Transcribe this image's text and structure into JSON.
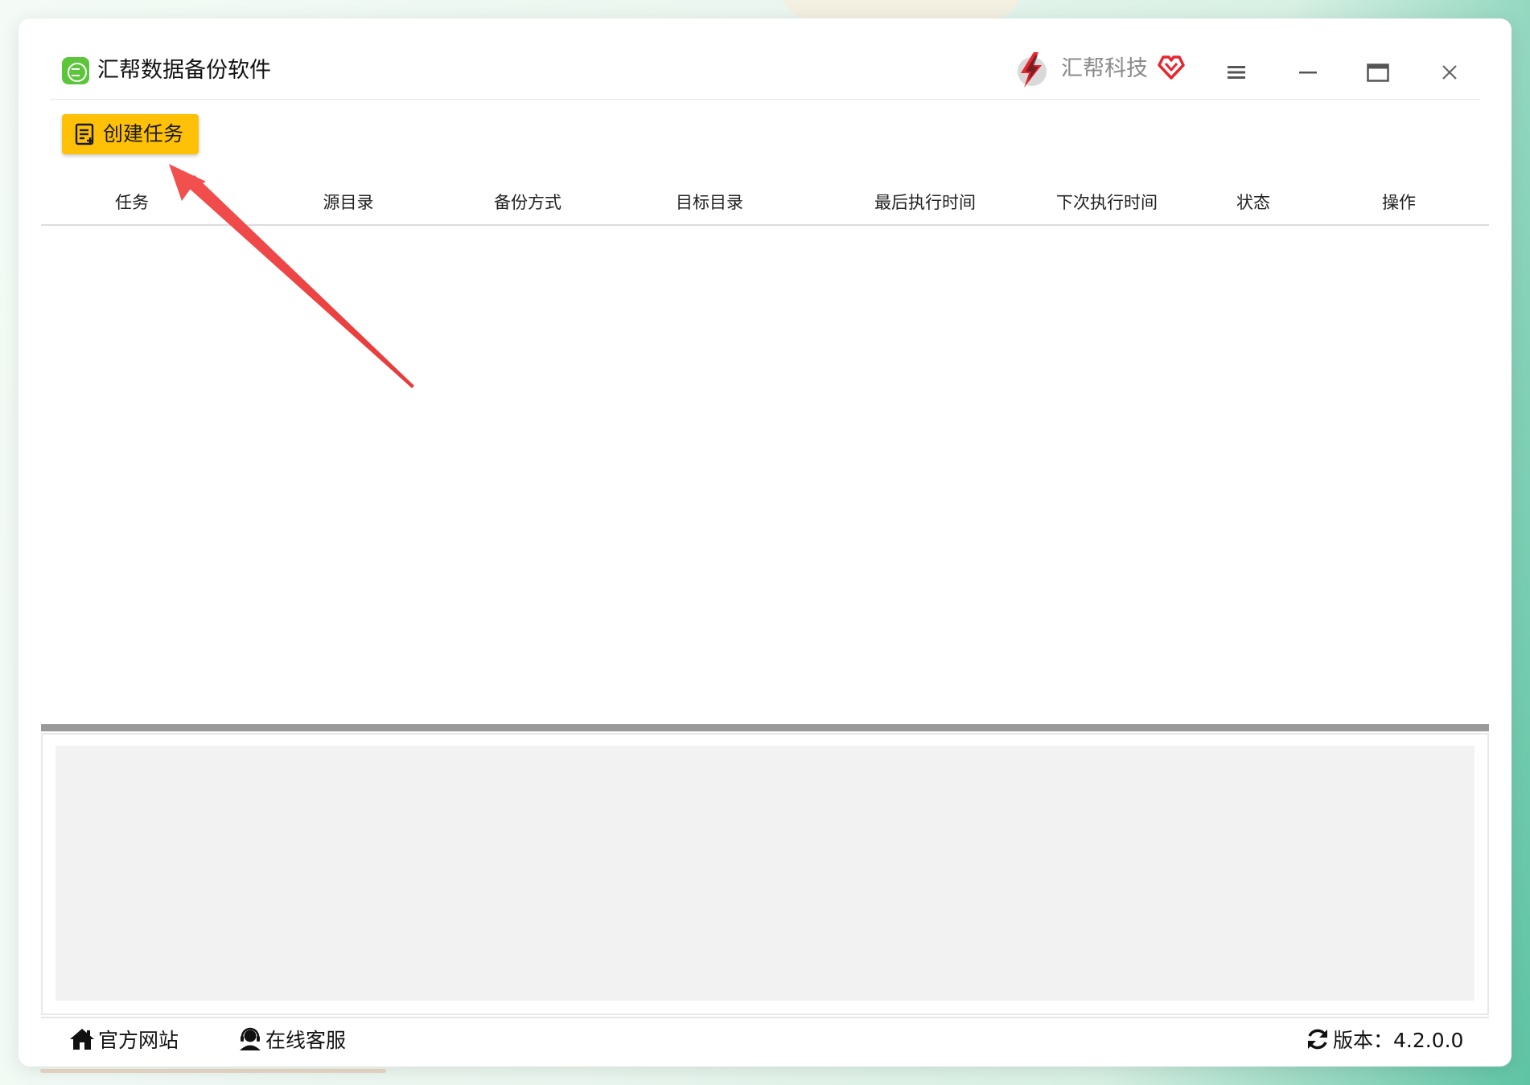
{
  "app": {
    "title": "汇帮数据备份软件",
    "icon": "backup-app-icon"
  },
  "brand": {
    "name": "汇帮科技",
    "logo_icon": "lightning-logo-icon",
    "heart_icon": "heart-diamond-icon"
  },
  "window_controls": {
    "menu_icon": "hamburger-menu-icon",
    "minimize_icon": "minimize-icon",
    "maximize_icon": "maximize-icon",
    "close_icon": "close-icon"
  },
  "toolbar": {
    "create_task_label": "创建任务",
    "create_task_icon": "task-list-icon"
  },
  "table": {
    "columns": [
      "任务",
      "源目录",
      "备份方式",
      "目标目录",
      "最后执行时间",
      "下次执行时间",
      "状态",
      "操作"
    ],
    "rows": []
  },
  "footer": {
    "website_label": "官方网站",
    "website_icon": "home-icon",
    "support_label": "在线客服",
    "support_icon": "headset-user-icon",
    "version_label": "版本：4.2.0.0",
    "version_icon": "refresh-icon"
  },
  "colors": {
    "accent": "#ffc107",
    "app_icon": "#5cc63a",
    "annotation_arrow": "#f24f4f",
    "brand_red": "#e8252f"
  }
}
